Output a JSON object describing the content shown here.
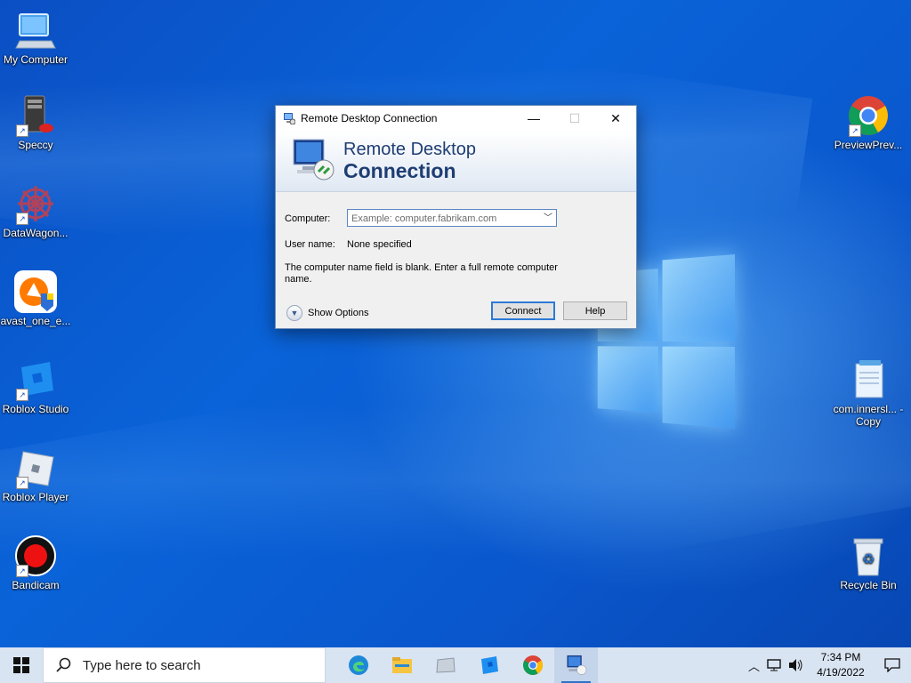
{
  "desktop": {
    "icons_left": [
      {
        "label": "My Computer",
        "icon": "computer-icon"
      },
      {
        "label": "Speccy",
        "icon": "speccy-icon"
      },
      {
        "label": "DataWagon...",
        "icon": "datawagon-icon"
      },
      {
        "label": "avast_one_e...",
        "icon": "avast-icon"
      },
      {
        "label": "Roblox Studio",
        "icon": "roblox-studio-icon"
      },
      {
        "label": "Roblox Player",
        "icon": "roblox-player-icon"
      },
      {
        "label": "Bandicam",
        "icon": "bandicam-icon"
      }
    ],
    "icons_right": [
      {
        "label": "PreviewPrev...",
        "icon": "chrome-icon"
      },
      {
        "label": "com.innersl... - Copy",
        "icon": "notepad-file-icon"
      },
      {
        "label": "Recycle Bin",
        "icon": "recycle-bin-icon"
      }
    ]
  },
  "dialog": {
    "title": "Remote Desktop Connection",
    "banner_line1": "Remote Desktop",
    "banner_line2": "Connection",
    "computer_label": "Computer:",
    "computer_placeholder": "Example: computer.fabrikam.com",
    "username_label": "User name:",
    "username_value": "None specified",
    "message": "The computer name field is blank. Enter a full remote computer name.",
    "show_options": "Show Options",
    "connect": "Connect",
    "help": "Help"
  },
  "taskbar": {
    "search_placeholder": "Type here to search",
    "apps": [
      "edge-icon",
      "file-explorer-icon",
      "folder-app-icon",
      "roblox-studio-icon",
      "chrome-icon",
      "remote-desktop-icon"
    ],
    "time": "7:34 PM",
    "date": "4/19/2022"
  },
  "colors": {
    "accent": "#2c7ad6",
    "banner_text": "#1e3d73",
    "taskbar_bg": "#d9e4f2"
  }
}
